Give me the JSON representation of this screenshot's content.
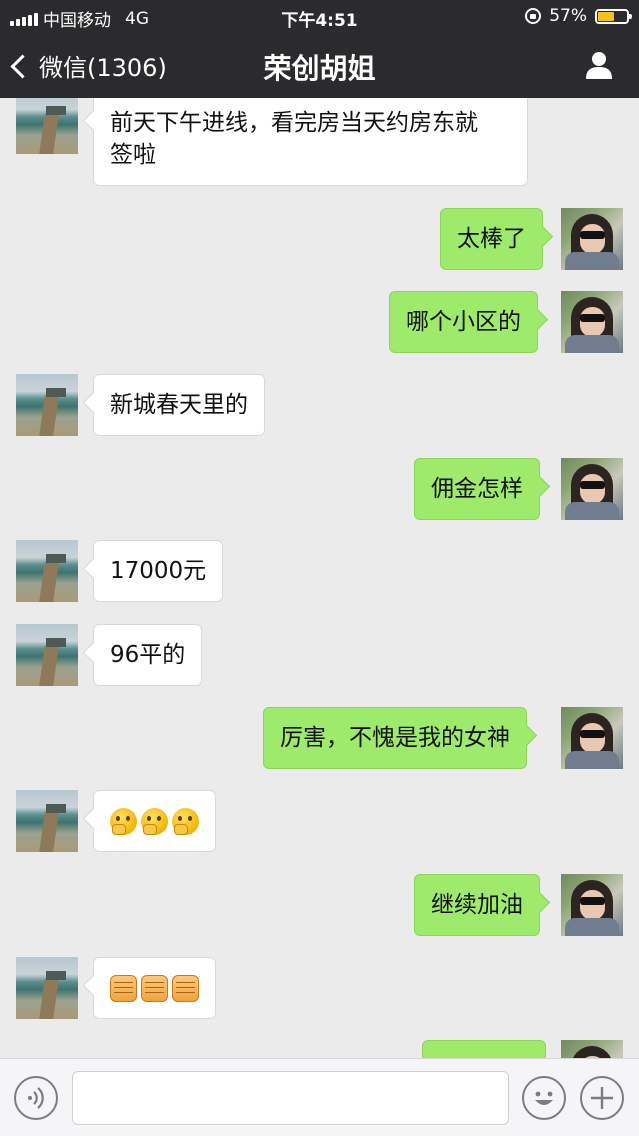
{
  "status_bar": {
    "carrier": "中国移动",
    "network": "4G",
    "time": "下午4:51",
    "battery_percent": "57%",
    "battery_level": 0.57,
    "icons": [
      "signal-icon",
      "rotation-lock-icon",
      "battery-icon"
    ]
  },
  "nav": {
    "back_label": "微信(1306)",
    "title": "荣创胡姐",
    "icons": [
      "chevron-left-icon",
      "person-icon"
    ]
  },
  "messages": [
    {
      "side": "in",
      "type": "text",
      "text": "前天下午进线，看完房当天约房东就\n签啦"
    },
    {
      "side": "out",
      "type": "text",
      "text": "太棒了"
    },
    {
      "side": "out",
      "type": "text",
      "text": "哪个小区的"
    },
    {
      "side": "in",
      "type": "text",
      "text": "新城春天里的"
    },
    {
      "side": "out",
      "type": "text",
      "text": "佣金怎样"
    },
    {
      "side": "in",
      "type": "text",
      "text": "17000元"
    },
    {
      "side": "in",
      "type": "text",
      "text": "96平的"
    },
    {
      "side": "out",
      "type": "text",
      "text": "厉害，不愧是我的女神"
    },
    {
      "side": "in",
      "type": "emoji",
      "emoji": "thinking-face-icon",
      "count": 3
    },
    {
      "side": "out",
      "type": "text",
      "text": "继续加油"
    },
    {
      "side": "in",
      "type": "emoji",
      "emoji": "raised-fist-icon",
      "count": 3
    },
    {
      "side": "out",
      "type": "partial",
      "text": ""
    }
  ],
  "input_bar": {
    "value": "",
    "icons": [
      "voice-icon",
      "emoji-face-icon",
      "plus-icon"
    ]
  },
  "colors": {
    "bar_bg": "#2b2b2e",
    "chat_bg": "#ebebeb",
    "outgoing_bubble": "#9eea6a",
    "incoming_bubble": "#ffffff",
    "battery_fill": "#f5c419"
  }
}
